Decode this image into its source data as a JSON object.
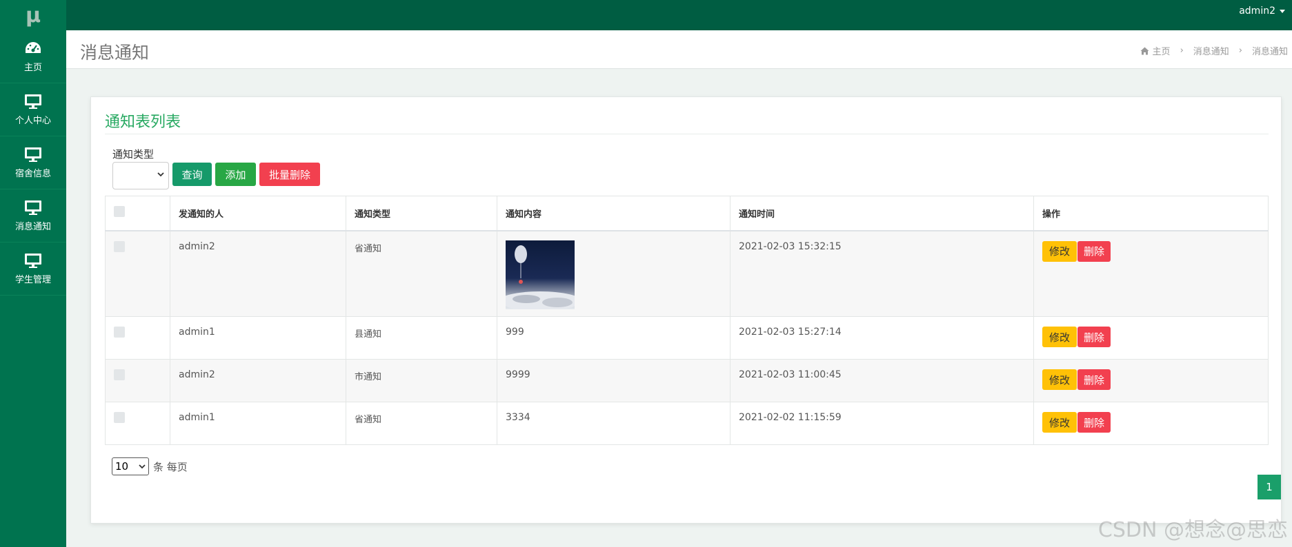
{
  "logo": "μ",
  "topbar": {
    "user": "admin2"
  },
  "sidebar": {
    "items": [
      {
        "label": "主页",
        "icon": "dashboard-icon"
      },
      {
        "label": "个人中心",
        "icon": "monitor-icon"
      },
      {
        "label": "宿舍信息",
        "icon": "monitor-icon"
      },
      {
        "label": "消息通知",
        "icon": "monitor-icon"
      },
      {
        "label": "学生管理",
        "icon": "monitor-icon"
      }
    ]
  },
  "header": {
    "title": "消息通知",
    "breadcrumb": [
      "主页",
      "消息通知",
      "消息通知"
    ]
  },
  "card": {
    "title": "通知表列表",
    "filter_label": "通知类型",
    "filter_value": "",
    "buttons": {
      "query": "查询",
      "add": "添加",
      "batch_delete": "批量删除"
    }
  },
  "table": {
    "headers": [
      "发通知的人",
      "通知类型",
      "通知内容",
      "通知时间",
      "操作"
    ],
    "rows": [
      {
        "sender": "admin2",
        "type": "省通知",
        "content": "",
        "content_is_image": true,
        "time": "2021-02-03 15:32:15"
      },
      {
        "sender": "admin1",
        "type": "县通知",
        "content": "999",
        "content_is_image": false,
        "time": "2021-02-03 15:27:14"
      },
      {
        "sender": "admin2",
        "type": "市通知",
        "content": "9999",
        "content_is_image": false,
        "time": "2021-02-03 11:00:45"
      },
      {
        "sender": "admin1",
        "type": "省通知",
        "content": "3334",
        "content_is_image": false,
        "time": "2021-02-02 11:15:59"
      }
    ],
    "edit_label": "修改",
    "delete_label": "删除"
  },
  "pagination": {
    "page_size": "10",
    "page_size_suffix": "条 每页",
    "current_page": "1"
  },
  "watermark": "CSDN @想念@思恋",
  "colors": {
    "topbar": "#005d42",
    "sidebar": "#00734f",
    "accent": "#28a962",
    "edit": "#ffc107",
    "delete": "#f2404f"
  }
}
